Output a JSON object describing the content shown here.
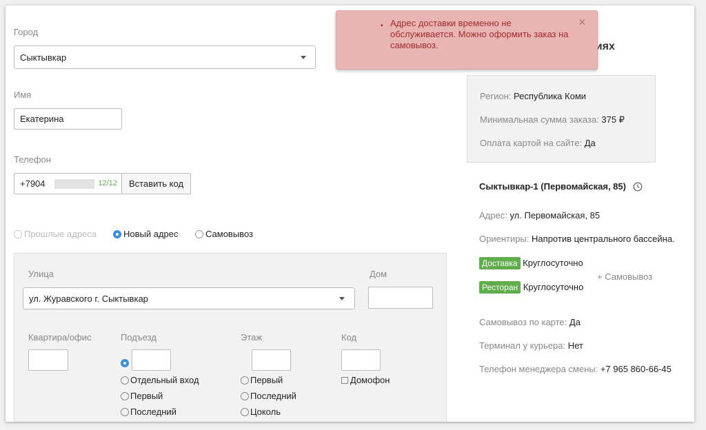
{
  "form": {
    "city_label": "Город",
    "city_value": "Сыктывкар",
    "name_label": "Имя",
    "name_value": "Екатерина",
    "phone_label": "Телефон",
    "phone_value": "+7904",
    "phone_counter": "12/12",
    "insert_code_label": "Вставить код",
    "address_options": {
      "past": "Прошлые адреса",
      "new": "Новый адрес",
      "pickup": "Самовывоз"
    },
    "street_label": "Улица",
    "street_value": "ул. Журавского г. Сыктывкар",
    "house_label": "Дом",
    "apt_label": "Квартира/офис",
    "entrance_label": "Подъезд",
    "floor_label": "Этаж",
    "code_label": "Код",
    "entrance_options": [
      "Отдельный вход",
      "Первый",
      "Последний"
    ],
    "floor_options": [
      "Первый",
      "Последний",
      "Цоколь"
    ],
    "intercom_label": "Домофон"
  },
  "alert": {
    "message": "Адрес доставки временно не обслуживается. Можно оформить заказ на самовывоз.",
    "close_symbol": "×",
    "partial_heading": "риях"
  },
  "info": {
    "region_label": "Регион:",
    "region_value": "Республика Коми",
    "min_order_label": "Минимальная сумма заказа:",
    "min_order_value": "375 ₽",
    "card_pay_label": "Оплата картой на сайте:",
    "card_pay_value": "Да"
  },
  "store": {
    "name": "Сыктывкар-1 (Первомайская, 85)",
    "address_label": "Адрес:",
    "address_value": "ул. Первомайская, 85",
    "landmarks_label": "Ориентиры:",
    "landmarks_value": "Напротив центрального бассейна.",
    "delivery_badge": "Доставка",
    "delivery_hours": "Круглосуточно",
    "restaurant_badge": "Ресторан",
    "restaurant_hours": "Круглосуточно",
    "pickup_extra": "+ Самовывоз",
    "card_pickup_label": "Самовывоз по карте:",
    "card_pickup_value": "Да",
    "courier_terminal_label": "Терминал у курьера:",
    "courier_terminal_value": "Нет",
    "manager_phone_label": "Телефон менеджера смены:",
    "manager_phone_value": "+7 965 860-66-45"
  }
}
